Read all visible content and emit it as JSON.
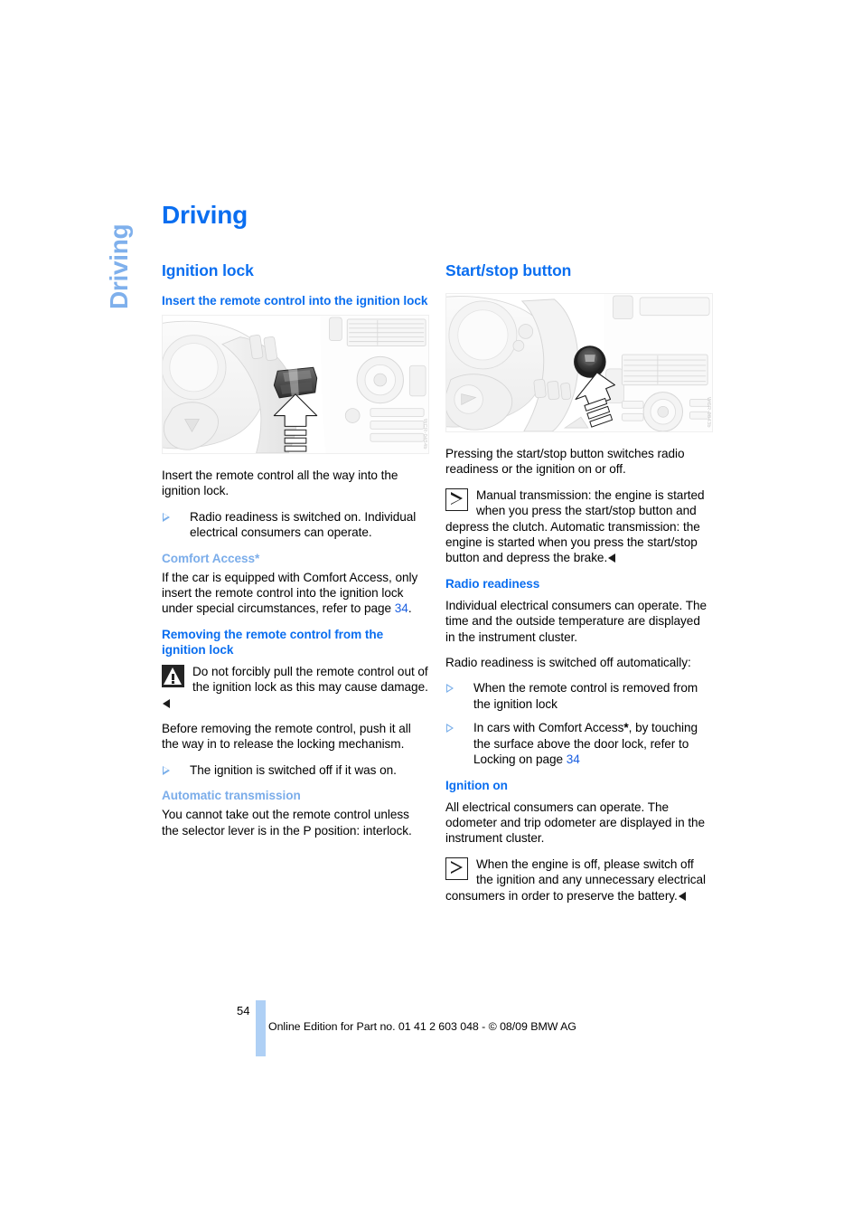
{
  "document": {
    "chapter_tab": "Driving",
    "chapter_title": "Driving"
  },
  "left_column": {
    "section_heading": "Ignition lock",
    "sub1_heading": "Insert the remote control into the ignition lock",
    "figure1": {
      "alt": "Dashboard with remote control inserted into ignition lock, arrow pointing in",
      "watermark": "WCR-0454b"
    },
    "para1": "Insert the remote control all the way into the ignition lock.",
    "bullets1": [
      "Radio readiness is switched on. Individual electrical consumers can operate."
    ],
    "comfort_access_heading": "Comfort Access*",
    "comfort_access_text_before": "If the car is equipped with Comfort Access, only insert the remote control into the ignition lock under special circumstances, refer to page ",
    "comfort_access_page": "34",
    "comfort_access_text_after": ".",
    "removing_heading": "Removing the remote control from the ignition lock",
    "warning_text": "Do not forcibly pull the remote control out of the ignition lock as this may cause damage.",
    "para2": "Before removing the remote control, push it all the way in to release the locking mechanism.",
    "bullets2": [
      "The ignition is switched off if it was on."
    ],
    "auto_trans_heading": "Automatic transmission",
    "auto_trans_text": "You cannot take out the remote control unless the selector lever is in the P position: interlock."
  },
  "right_column": {
    "section_heading": "Start/stop button",
    "figure2": {
      "alt": "Steering wheel and dashboard with start/stop button, arrow pointing at button",
      "watermark": "WCR-0843b"
    },
    "para1": "Pressing the start/stop button switches radio readiness or the ignition on or off.",
    "note1_text": "Manual transmission: the engine is started when you press the start/stop button and depress the clutch. Automatic transmission: the engine is started when you press the start/stop button and depress the brake.",
    "note1_line1": "Manual transmission: the engine is started when you press the start/stop button and depress the clutch.",
    "note1_line2": "Automatic transmission: the engine is started when you press the start/stop button and depress the brake.",
    "radio_heading": "Radio readiness",
    "radio_para1": "Individual electrical consumers can operate. The time and the outside temperature are displayed in the instrument cluster.",
    "radio_para2": "Radio readiness is switched off automatically:",
    "radio_bullet1": "When the remote control is removed from the ignition lock",
    "radio_bullet2_before": "In cars with Comfort Access",
    "radio_bullet2_star": "*",
    "radio_bullet2_mid": ", by touching the surface above the door lock, refer to Locking on page ",
    "radio_bullet2_page": "34",
    "ignition_on_heading": "Ignition on",
    "ignition_on_para": "All electrical consumers can operate. The odometer and trip odometer are displayed in the instrument cluster.",
    "ignition_on_note": "When the engine is off, please switch off the ignition and any unnecessary electrical consumers in order to preserve the battery."
  },
  "footer": {
    "page_number": "54",
    "imprint": "Online Edition for Part no. 01 41 2 603 048 - © 08/09 BMW AG"
  },
  "colors": {
    "heading_blue": "#0a6ef0",
    "light_blue": "#7badea",
    "tab_blue": "#7fb0ec",
    "footer_bar": "#afd0f5",
    "bullet_blue": "#78aeea"
  }
}
